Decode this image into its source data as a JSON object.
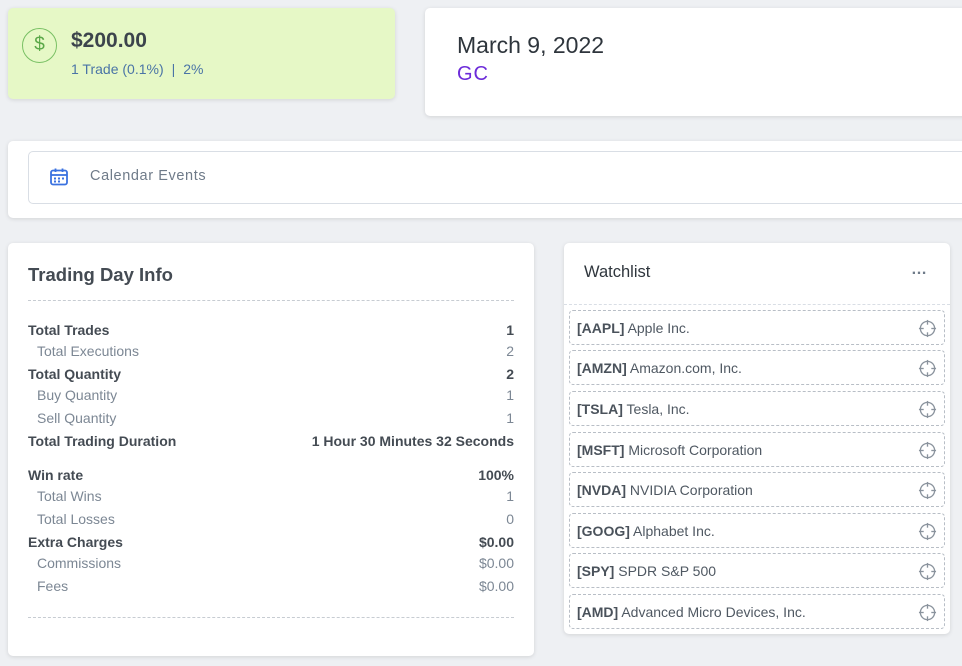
{
  "pnl": {
    "icon": "dollar-icon",
    "icon_glyph": "$",
    "amount": "$200.00",
    "trades": "1 Trade (0.1%)",
    "separator": "|",
    "percent": "2%",
    "accent": "#e6f8c6"
  },
  "day": {
    "date": "March 9, 2022",
    "symbol": "GC",
    "symbol_color": "#6c2bd9"
  },
  "calendar": {
    "icon": "calendar-icon",
    "label": "Calendar Events"
  },
  "info": {
    "title": "Trading Day Info",
    "rows": [
      {
        "label": "Total Trades",
        "value": "1"
      },
      {
        "label": "Total Executions",
        "value": "2"
      },
      {
        "label": "Total Quantity",
        "value": "2"
      },
      {
        "label": "Buy Quantity",
        "value": "1"
      },
      {
        "label": "Sell Quantity",
        "value": "1"
      },
      {
        "label": "Total Trading Duration",
        "value": "1 Hour 30 Minutes 32 Seconds"
      },
      {
        "label": "Win rate",
        "value": "100%"
      },
      {
        "label": "Total Wins",
        "value": "1"
      },
      {
        "label": "Total Losses",
        "value": "0"
      },
      {
        "label": "Extra Charges",
        "value": "$0.00"
      },
      {
        "label": "Commissions",
        "value": "$0.00"
      },
      {
        "label": "Fees",
        "value": "$0.00"
      }
    ]
  },
  "watchlist": {
    "title": "Watchlist",
    "more": "…",
    "items": [
      {
        "ticker": "[AAPL]",
        "name": "Apple Inc.",
        "icon": "crosshair-icon"
      },
      {
        "ticker": "[AMZN]",
        "name": "Amazon.com, Inc.",
        "icon": "crosshair-icon"
      },
      {
        "ticker": "[TSLA]",
        "name": "Tesla, Inc.",
        "icon": "crosshair-icon"
      },
      {
        "ticker": "[MSFT]",
        "name": "Microsoft Corporation",
        "icon": "crosshair-icon"
      },
      {
        "ticker": "[NVDA]",
        "name": "NVIDIA Corporation",
        "icon": "crosshair-icon"
      },
      {
        "ticker": "[GOOG]",
        "name": "Alphabet Inc.",
        "icon": "crosshair-icon"
      },
      {
        "ticker": "[SPY]",
        "name": "SPDR S&P 500",
        "icon": "crosshair-icon"
      },
      {
        "ticker": "[AMD]",
        "name": "Advanced Micro Devices, Inc.",
        "icon": "crosshair-icon"
      }
    ]
  }
}
